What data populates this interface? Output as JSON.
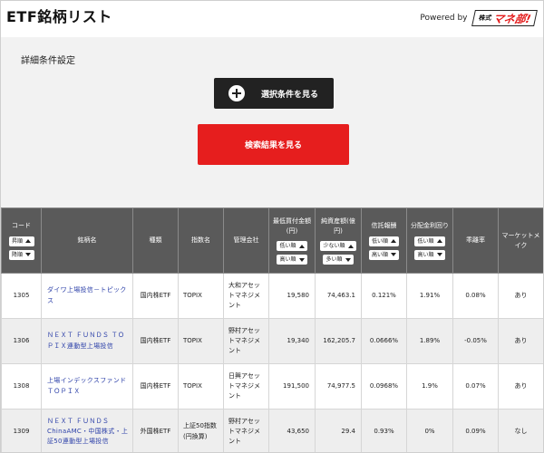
{
  "header": {
    "title": "ETF銘柄リスト",
    "powered_by": "Powered by",
    "logo_small": "株式",
    "logo_main": "マネ部!"
  },
  "settings": {
    "title": "詳細条件設定",
    "options_button": "選択条件を見る",
    "results_button": "検索結果を見る"
  },
  "table": {
    "headers": {
      "code": "コード",
      "name": "銘柄名",
      "type": "種類",
      "index": "指数名",
      "manager": "管理会社",
      "min_invest": "最低買付金額(円)",
      "net_assets": "純資産額(億円)",
      "fee": "信託報酬",
      "dividend": "分配金利回り",
      "deviation": "乖離率",
      "market_make": "マーケットメイク"
    },
    "sort": {
      "code_asc": "昇順",
      "code_desc": "降順",
      "low": "低い順",
      "high": "高い順",
      "few": "少ない順",
      "many": "多い順"
    },
    "rows": [
      {
        "code": "1305",
        "name": "ダイワ上場投信－トピックス",
        "type": "国内株ETF",
        "index": "TOPIX",
        "manager": "大和アセットマネジメント",
        "min_invest": "19,580",
        "net_assets": "74,463.1",
        "fee": "0.121%",
        "dividend": "1.91%",
        "deviation": "0.08%",
        "market_make": "あり"
      },
      {
        "code": "1306",
        "name": "ＮＥＸＴ ＦＵＮＤＳ ＴＯＰＩＸ連動型上場投信",
        "type": "国内株ETF",
        "index": "TOPIX",
        "manager": "野村アセットマネジメント",
        "min_invest": "19,340",
        "net_assets": "162,205.7",
        "fee": "0.0666%",
        "dividend": "1.89%",
        "deviation": "-0.05%",
        "market_make": "あり"
      },
      {
        "code": "1308",
        "name": "上場インデックスファンドＴＯＰＩＸ",
        "type": "国内株ETF",
        "index": "TOPIX",
        "manager": "日興アセットマネジメント",
        "min_invest": "191,500",
        "net_assets": "74,977.5",
        "fee": "0.0968%",
        "dividend": "1.9%",
        "deviation": "0.07%",
        "market_make": "あり"
      },
      {
        "code": "1309",
        "name": "ＮＥＸＴ ＦＵＮＤＳ ChinaAMC・中国株式・上証50連動型上場投信",
        "type": "外国株ETF",
        "index": "上証50指数(円換算)",
        "manager": "野村アセットマネジメント",
        "min_invest": "43,650",
        "net_assets": "29.4",
        "fee": "0.93%",
        "dividend": "0%",
        "deviation": "0.09%",
        "market_make": "なし"
      }
    ]
  }
}
